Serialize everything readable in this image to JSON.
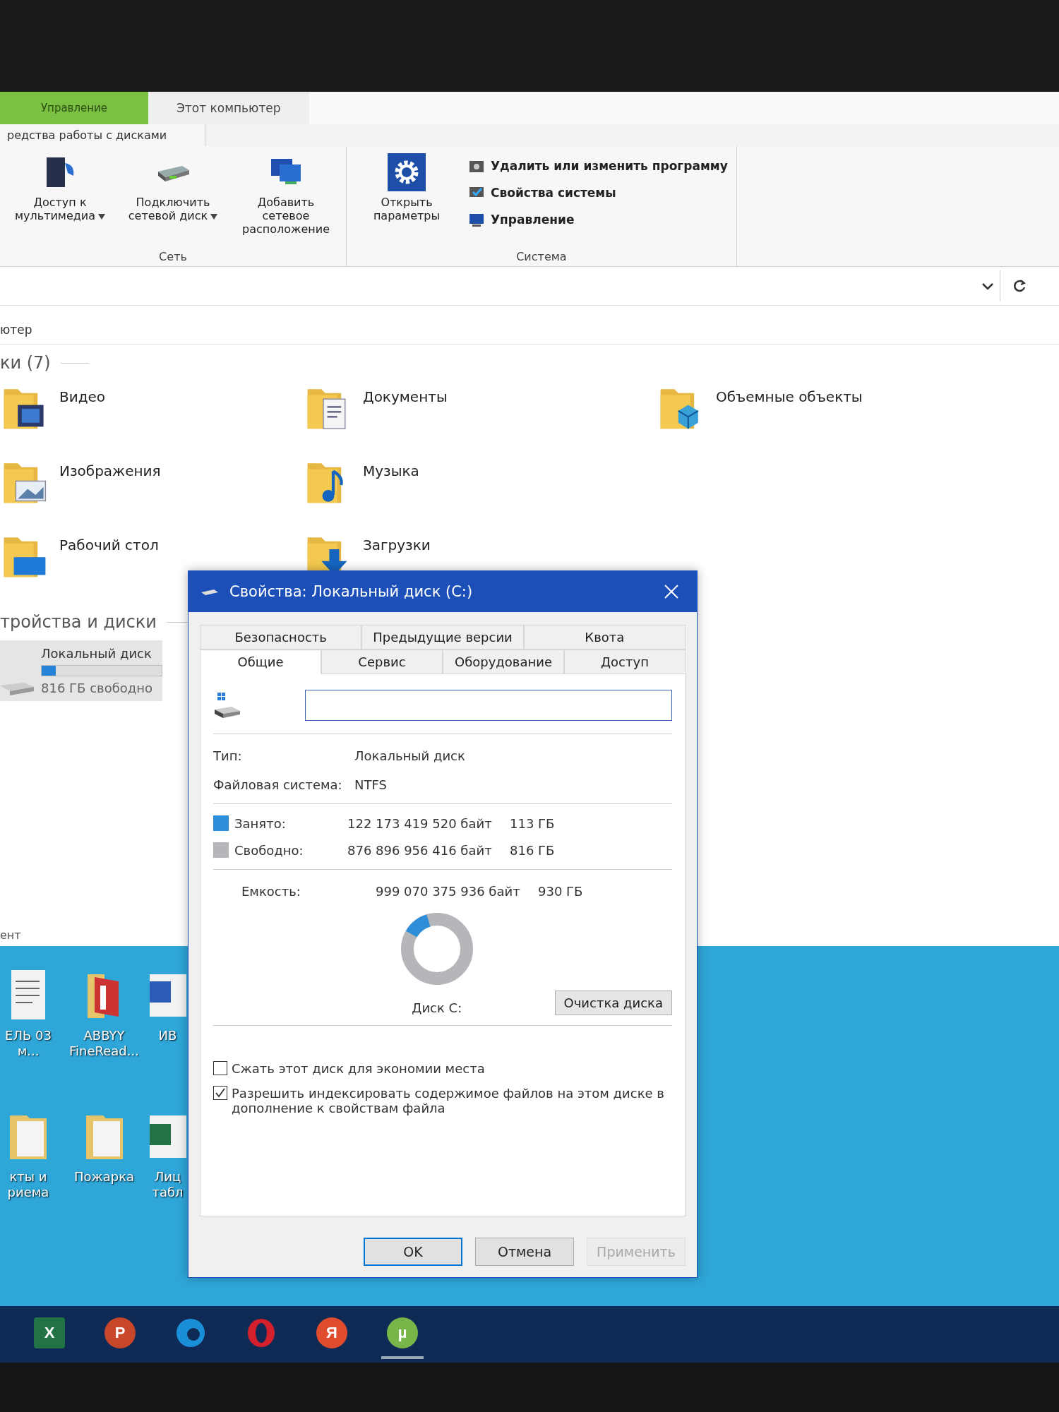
{
  "explorer": {
    "ribbon_tabs": [
      {
        "label": "Управление",
        "kind": "context",
        "selected": false
      },
      {
        "label": "Этот компьютер",
        "kind": "plain",
        "selected": false
      }
    ],
    "context_caption": "редства работы с дисками",
    "ribbon_groups": [
      {
        "label": "Сеть",
        "large_buttons": [
          {
            "label": "Доступ к мультимедиа",
            "kind": "media",
            "dropdown": true
          },
          {
            "label": "Подключить сетевой диск",
            "kind": "drive",
            "dropdown": true
          },
          {
            "label": "Добавить сетевое расположение",
            "kind": "network",
            "dropdown": false
          }
        ]
      },
      {
        "label": "Система",
        "large_buttons": [
          {
            "label": "Открыть параметры",
            "kind": "gear",
            "dropdown": false
          }
        ],
        "small_buttons": [
          {
            "label": "Удалить или изменить программу",
            "kind": "uninstall"
          },
          {
            "label": "Свойства системы",
            "kind": "check"
          },
          {
            "label": "Управление",
            "kind": "manage"
          }
        ]
      }
    ],
    "breadcrumb": "ютер",
    "folders_header": "ки (7)",
    "folders": [
      {
        "name": "Видео",
        "kind": "video"
      },
      {
        "name": "Изображения",
        "kind": "pictures"
      },
      {
        "name": "Рабочий стол",
        "kind": "desktop"
      },
      {
        "name": "Документы",
        "kind": "documents"
      },
      {
        "name": "Музыка",
        "kind": "music"
      },
      {
        "name": "Загрузки",
        "kind": "downloads"
      },
      {
        "name": "Объемные объекты",
        "kind": "objects"
      }
    ],
    "devices_header": "тройства и диски",
    "drives": [
      {
        "name": "Локальный диск",
        "free": "816 ГБ свободно",
        "level": 0.12
      }
    ],
    "status_bar": "ент"
  },
  "desktop_icons": [
    {
      "label": "ЕЛЬ 03 м...",
      "kind": "document"
    },
    {
      "label": "ABBYY FineRead...",
      "kind": "abbyy"
    },
    {
      "label": "ИВ",
      "kind": "word"
    },
    {
      "label": "кты и риема",
      "kind": "folder"
    },
    {
      "label": "Пожарка",
      "kind": "folder"
    },
    {
      "label": "Лиц табл",
      "kind": "excel"
    }
  ],
  "dialog": {
    "title": "Свойства: Локальный диск (C:)",
    "tab_rows": [
      [
        {
          "label": "Безопасность",
          "selected": false
        },
        {
          "label": "Предыдущие версии",
          "selected": false
        },
        {
          "label": "Квота",
          "selected": false
        }
      ],
      [
        {
          "label": "Общие",
          "selected": true
        },
        {
          "label": "Сервис",
          "selected": false
        },
        {
          "label": "Оборудование",
          "selected": false
        },
        {
          "label": "Доступ",
          "selected": false
        }
      ]
    ],
    "info": [
      {
        "label": "Тип:",
        "value": "Локальный диск"
      },
      {
        "label": "Файловая система:",
        "value": "NTFS"
      }
    ],
    "space": [
      {
        "label": "Занято:",
        "bytes": "122 173 419 520 байт",
        "size": "113 ГБ",
        "color": "#2e8fd8"
      },
      {
        "label": "Свободно:",
        "bytes": "876 896 956 416 байт",
        "size": "816 ГБ",
        "color": "#b4b6ba"
      }
    ],
    "capacity": {
      "label": "Емкость:",
      "bytes": "999 070 375 936 байт",
      "size": "930 ГБ"
    },
    "usage": {
      "level": 0.12
    },
    "disk_label": "Диск C:",
    "cleanup_button": "Очистка диска",
    "options": [
      {
        "label": "Сжать этот диск для экономии места",
        "checked": false
      },
      {
        "label": "Разрешить индексировать содержимое файлов на этом диске в дополнение к свойствам файла",
        "checked": true
      }
    ],
    "buttons": [
      {
        "label": "OK",
        "default": true,
        "disabled": false
      },
      {
        "label": "Отмена",
        "default": false,
        "disabled": false
      },
      {
        "label": "Применить",
        "default": false,
        "disabled": true
      }
    ]
  },
  "taskbar": [
    {
      "kind": "excel",
      "glyph": "X",
      "active": false
    },
    {
      "kind": "powerpoint",
      "glyph": "P",
      "active": false
    },
    {
      "kind": "edge",
      "active": false
    },
    {
      "kind": "opera",
      "active": false
    },
    {
      "kind": "yandex",
      "glyph": "Я",
      "active": false
    },
    {
      "kind": "torrent",
      "glyph": "µ",
      "active": true
    }
  ]
}
